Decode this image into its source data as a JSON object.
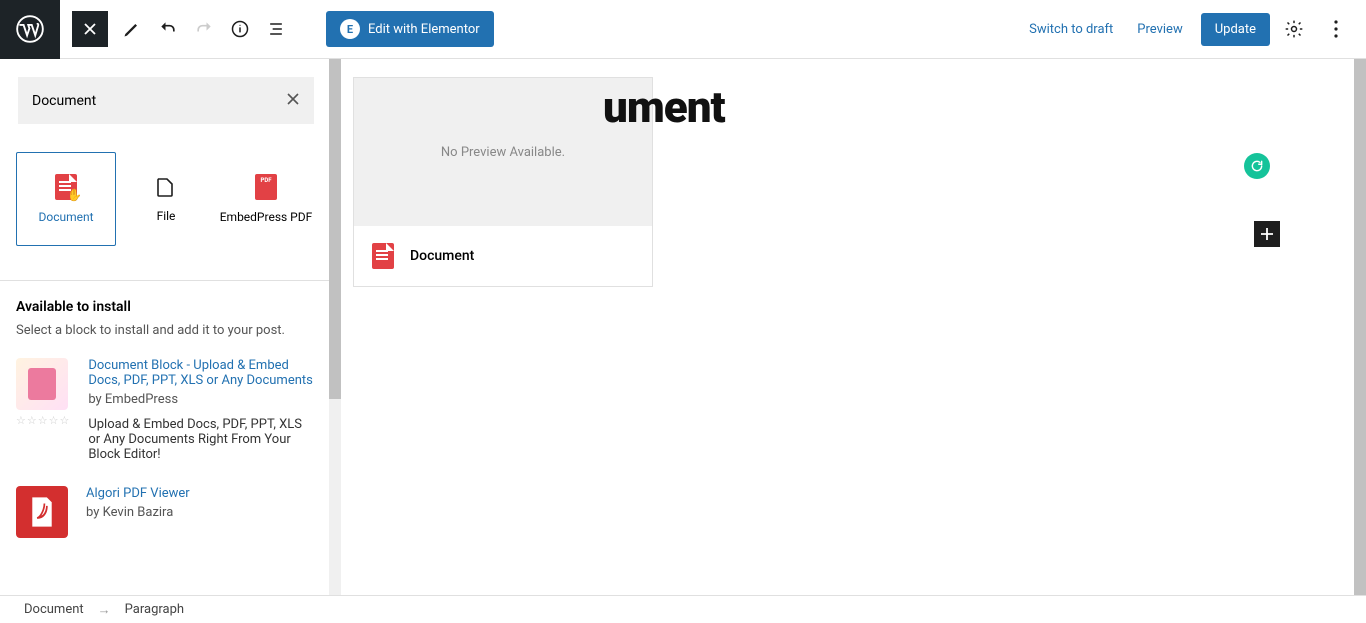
{
  "topbar": {
    "elementor_label": "Edit with Elementor",
    "switch_draft": "Switch to draft",
    "preview": "Preview",
    "update": "Update"
  },
  "sidebar": {
    "search_value": "Document",
    "blocks": [
      {
        "label": "Document"
      },
      {
        "label": "File"
      },
      {
        "label": "EmbedPress PDF"
      }
    ],
    "avail_title": "Available to install",
    "avail_sub": "Select a block to install and add it to your post.",
    "plugins": [
      {
        "name": "Document Block - Upload & Embed Docs, PDF, PPT, XLS or Any Documents",
        "by": "by EmbedPress",
        "desc": "Upload & Embed Docs, PDF, PPT, XLS or Any Documents Right From Your Block Editor!"
      },
      {
        "name": "Algori PDF Viewer",
        "by": "by Kevin Bazira",
        "desc": ""
      }
    ]
  },
  "canvas": {
    "title_fragment": "ument",
    "no_preview": "No Preview Available.",
    "block_label": "Document"
  },
  "footer": {
    "crumb1": "Document",
    "crumb2": "Paragraph"
  }
}
